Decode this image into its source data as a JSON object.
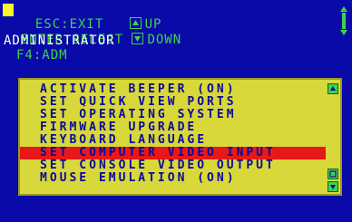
{
  "header": {
    "line1": {
      "esc": "ESC:EXIT",
      "up": "UP"
    },
    "line2": {
      "enter": "ENTER:SELECT",
      "down": "DOWN"
    },
    "user": "ADMINISTRATOR",
    "hotkey": "F4:ADM"
  },
  "menu": {
    "items": [
      {
        "label": "ACTIVATE BEEPER (ON)"
      },
      {
        "label": "SET QUICK VIEW PORTS"
      },
      {
        "label": "SET OPERATING SYSTEM"
      },
      {
        "label": "FIRMWARE UPGRADE"
      },
      {
        "label": "KEYBOARD LANGUAGE"
      },
      {
        "label": "SET COMPUTER VIDEO INPUT"
      },
      {
        "label": "SET CONSOLE VIDEO OUTPUT"
      },
      {
        "label": "MOUSE EMULATION (ON)"
      }
    ],
    "selected_index": 5
  },
  "colors": {
    "background": "#0a0aa8",
    "panel": "#d8d83a",
    "highlight": "#e81818",
    "accent_green": "#3fd24a",
    "cursor_yellow": "#f6f62a"
  },
  "icons": {
    "up_key": "up-arrow-key-icon",
    "down_key": "down-arrow-key-icon",
    "scroll_up": "scroll-up-icon",
    "scroll_down": "scroll-down-icon"
  }
}
